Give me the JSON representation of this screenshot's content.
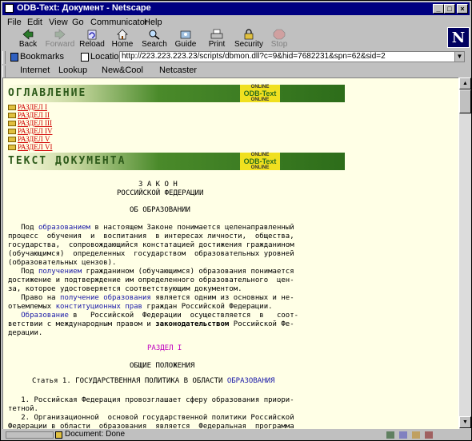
{
  "window": {
    "title": "ODB-Text: Документ - Netscape"
  },
  "menu": [
    "File",
    "Edit",
    "View",
    "Go",
    "Communicator",
    "Help"
  ],
  "toolbar": [
    {
      "label": "Back",
      "icon": "back-arrow-icon",
      "enabled": true
    },
    {
      "label": "Forward",
      "icon": "forward-arrow-icon",
      "enabled": false
    },
    {
      "label": "Reload",
      "icon": "reload-icon",
      "enabled": true
    },
    {
      "label": "Home",
      "icon": "home-icon",
      "enabled": true
    },
    {
      "label": "Search",
      "icon": "search-icon",
      "enabled": true
    },
    {
      "label": "Guide",
      "icon": "guide-icon",
      "enabled": true
    },
    {
      "label": "Print",
      "icon": "print-icon",
      "enabled": true
    },
    {
      "label": "Security",
      "icon": "lock-icon",
      "enabled": true
    },
    {
      "label": "Stop",
      "icon": "stop-icon",
      "enabled": false
    }
  ],
  "logo_letter": "N",
  "location": {
    "bookmarks_label": "Bookmarks",
    "label": "Location:",
    "url": "http://223.223.223.23/scripts/dbmon.dll?c=9&hid=7682231&spn=62&sid=2"
  },
  "personal": [
    "Internet",
    "Lookup",
    "New&Cool",
    "Netcaster"
  ],
  "page": {
    "toc_banner": "ОГЛАВЛЕНИЕ",
    "text_banner": "ТЕКСТ ДОКУМЕНТА",
    "logo_top": "ONLINE",
    "logo_main": "ODB-Text",
    "logo_bottom": "ONLINE",
    "sections": [
      "РАЗДЕЛ I",
      "РАЗДЕЛ II",
      "РАЗДЕЛ III",
      "РАЗДЕЛ IV",
      "РАЗДЕЛ V",
      "РАЗДЕЛ VI"
    ],
    "law_title": "З А К О Н",
    "law_subtitle": "РОССИЙСКОЙ ФЕДЕРАЦИИ",
    "law_name": "ОБ ОБРАЗОВАНИИ",
    "p1": {
      "l1a": "   Под ",
      "l1link": "образованием",
      "l1b": " в настоящем Законе понимается целенаправленный",
      "l2": "процесс  обучения  и  воспитания  в интересах личности,  общества,",
      "l3": "государства,  сопровождающийся констатацией достижения гражданином",
      "l4": "(обучающимся)  определенных  государством  образовательных уровней",
      "l5": "(образовательных цензов)."
    },
    "p2": {
      "l1a": "   Под ",
      "l1link": "получением",
      "l1b": " гражданином (обучающимся) образования понимается",
      "l2": "достижение и подтверждение им определенного образовательного  цен-",
      "l3": "за, которое удостоверяется соответствующим документом."
    },
    "p3": {
      "l1a": "   Право на ",
      "l1link": "получение образования",
      "l1b": " является одним из основных и не-",
      "l2a": "отъемлемых ",
      "l2link": "конституционных прав",
      "l2b": " граждан Российской Федерации."
    },
    "p4": {
      "l1pre": "   ",
      "l1link": "Образование",
      "l1b": " в   Российской  Федерации  осуществляется  в   соот-",
      "l2a": "ветствии с международным правом и ",
      "l2bold": "законодательством",
      "l2b": " Российской Фе-",
      "l3": "дерации."
    },
    "section_heading": "РАЗДЕЛ I",
    "section_title": "ОБЩИЕ ПОЛОЖЕНИЯ",
    "article_a": "Статья 1. ГОСУДАРСТВЕННАЯ ПОЛИТИКА В ОБЛАСТИ ",
    "article_link": "ОБРАЗОВАНИЯ",
    "a1": {
      "l1": "   1. Российская Федерация провозглашает сферу образования приори-",
      "l2": "тетной."
    },
    "a2": {
      "l1": "   2. Организационной  основой государственной политики Российской",
      "l2": "Федерации в области  образования  является  Федеральная  программа"
    }
  },
  "status": {
    "text": "Document: Done"
  },
  "colors": {
    "title_bar": "#000080",
    "page_bg": "#ffffe6",
    "link": "#1a1aa8",
    "toc_link": "#d00000",
    "section": "#c000c0",
    "banner_green": "#2d6d1a",
    "logo_yellow": "#f0e020"
  }
}
